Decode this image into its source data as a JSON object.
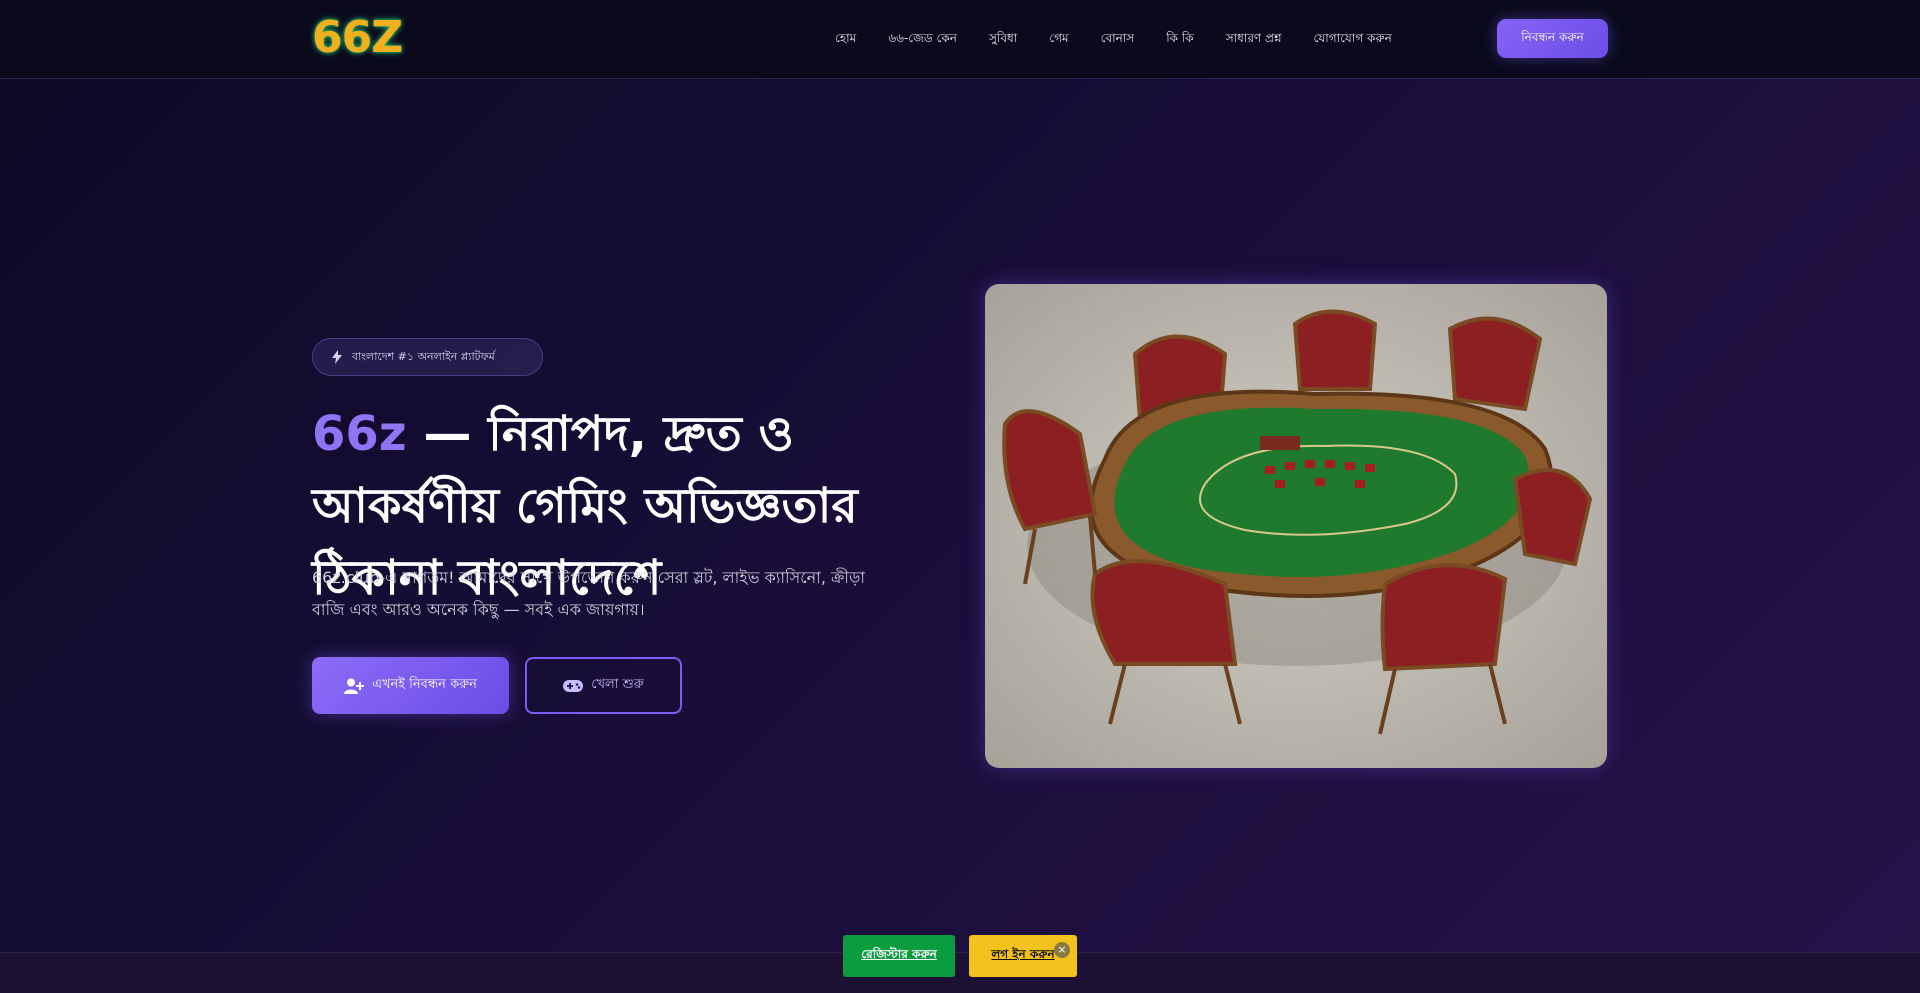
{
  "logo": {
    "text": "66Z"
  },
  "nav": {
    "items": [
      {
        "label": "হোম"
      },
      {
        "label": "৬৬-জেড কেন"
      },
      {
        "label": "সুবিধা"
      },
      {
        "label": "গেম"
      },
      {
        "label": "বোনাস"
      },
      {
        "label": "কি কি"
      },
      {
        "label": "সাধারণ প্রশ্ন"
      },
      {
        "label": "যোগাযোগ করুন"
      }
    ],
    "cta_label": "নিবন্ধন করুন"
  },
  "hero": {
    "badge": "বাংলাদেশ #১ অনলাইন প্ল্যাটফর্ম",
    "title_accent": "66z",
    "title_rest": " — নিরাপদ, দ্রুত ও আকর্ষণীয় গেমিং অভিজ্ঞতার ঠিকানা বাংলাদেশে",
    "description": "66z.club-এ স্বাগতম! আমাদের সাথে উপভোগ করুন সেরা স্লট, লাইভ ক্যাসিনো, ক্রীড়া বাজি এবং আরও অনেক কিছু — সবই এক জায়গায়।",
    "primary_button": "এখনই নিবন্ধন করুন",
    "secondary_button": "খেলা শুরু"
  },
  "hero_image": {
    "alt": "poker-table-illustration"
  },
  "bottom_bar": {
    "green_button": "রেজিস্টার করুন",
    "yellow_button": "লগ ইন করুন",
    "close_label": "×"
  },
  "colors": {
    "accent": "#8f74f4",
    "header_bg": "#0a0a1c",
    "green": "#0b9c3f",
    "yellow": "#f4c21c",
    "logo": "#f2b01e"
  }
}
